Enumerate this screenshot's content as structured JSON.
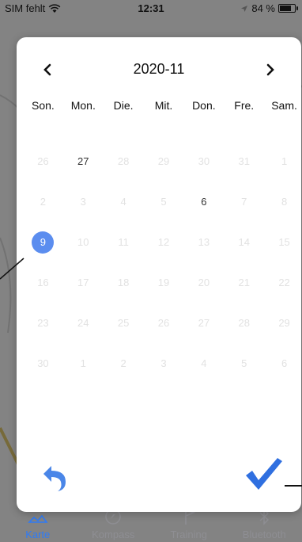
{
  "status_bar": {
    "carrier": "SIM fehlt",
    "time": "12:31",
    "battery_percent": "84 %",
    "battery_level": 0.84
  },
  "calendar": {
    "title": "2020-11",
    "weekdays": [
      "Son.",
      "Mon.",
      "Die.",
      "Mit.",
      "Don.",
      "Fre.",
      "Sam."
    ],
    "days": [
      {
        "d": "26",
        "enabled": false
      },
      {
        "d": "27",
        "enabled": true
      },
      {
        "d": "28",
        "enabled": false
      },
      {
        "d": "29",
        "enabled": false
      },
      {
        "d": "30",
        "enabled": false
      },
      {
        "d": "31",
        "enabled": false
      },
      {
        "d": "1",
        "enabled": false
      },
      {
        "d": "2",
        "enabled": false
      },
      {
        "d": "3",
        "enabled": false
      },
      {
        "d": "4",
        "enabled": false
      },
      {
        "d": "5",
        "enabled": false
      },
      {
        "d": "6",
        "enabled": true
      },
      {
        "d": "7",
        "enabled": false
      },
      {
        "d": "8",
        "enabled": false
      },
      {
        "d": "9",
        "enabled": true,
        "selected": true
      },
      {
        "d": "10",
        "enabled": false
      },
      {
        "d": "11",
        "enabled": false
      },
      {
        "d": "12",
        "enabled": false
      },
      {
        "d": "13",
        "enabled": false
      },
      {
        "d": "14",
        "enabled": false
      },
      {
        "d": "15",
        "enabled": false
      },
      {
        "d": "16",
        "enabled": false
      },
      {
        "d": "17",
        "enabled": false
      },
      {
        "d": "18",
        "enabled": false
      },
      {
        "d": "19",
        "enabled": false
      },
      {
        "d": "20",
        "enabled": false
      },
      {
        "d": "21",
        "enabled": false
      },
      {
        "d": "22",
        "enabled": false
      },
      {
        "d": "23",
        "enabled": false
      },
      {
        "d": "24",
        "enabled": false
      },
      {
        "d": "25",
        "enabled": false
      },
      {
        "d": "26",
        "enabled": false
      },
      {
        "d": "27",
        "enabled": false
      },
      {
        "d": "28",
        "enabled": false
      },
      {
        "d": "29",
        "enabled": false
      },
      {
        "d": "30",
        "enabled": false
      },
      {
        "d": "1",
        "enabled": false
      },
      {
        "d": "2",
        "enabled": false
      },
      {
        "d": "3",
        "enabled": false
      },
      {
        "d": "4",
        "enabled": false
      },
      {
        "d": "5",
        "enabled": false
      },
      {
        "d": "6",
        "enabled": false
      }
    ],
    "prev_icon": "chevron-left-icon",
    "next_icon": "chevron-right-icon",
    "back_icon": "undo-arrow-icon",
    "confirm_icon": "checkmark-icon"
  },
  "tabbar": {
    "tabs": [
      {
        "label": "Karte",
        "icon": "map-icon",
        "active": true
      },
      {
        "label": "Kompass",
        "icon": "compass-icon",
        "active": false
      },
      {
        "label": "Training",
        "icon": "flag-icon",
        "active": false
      },
      {
        "label": "Bluetooth",
        "icon": "bluetooth-icon",
        "active": false
      }
    ]
  },
  "colors": {
    "accent": "#2f7bf5",
    "selected_day": "#5b8def",
    "disabled_day": "#e2e2e2"
  }
}
